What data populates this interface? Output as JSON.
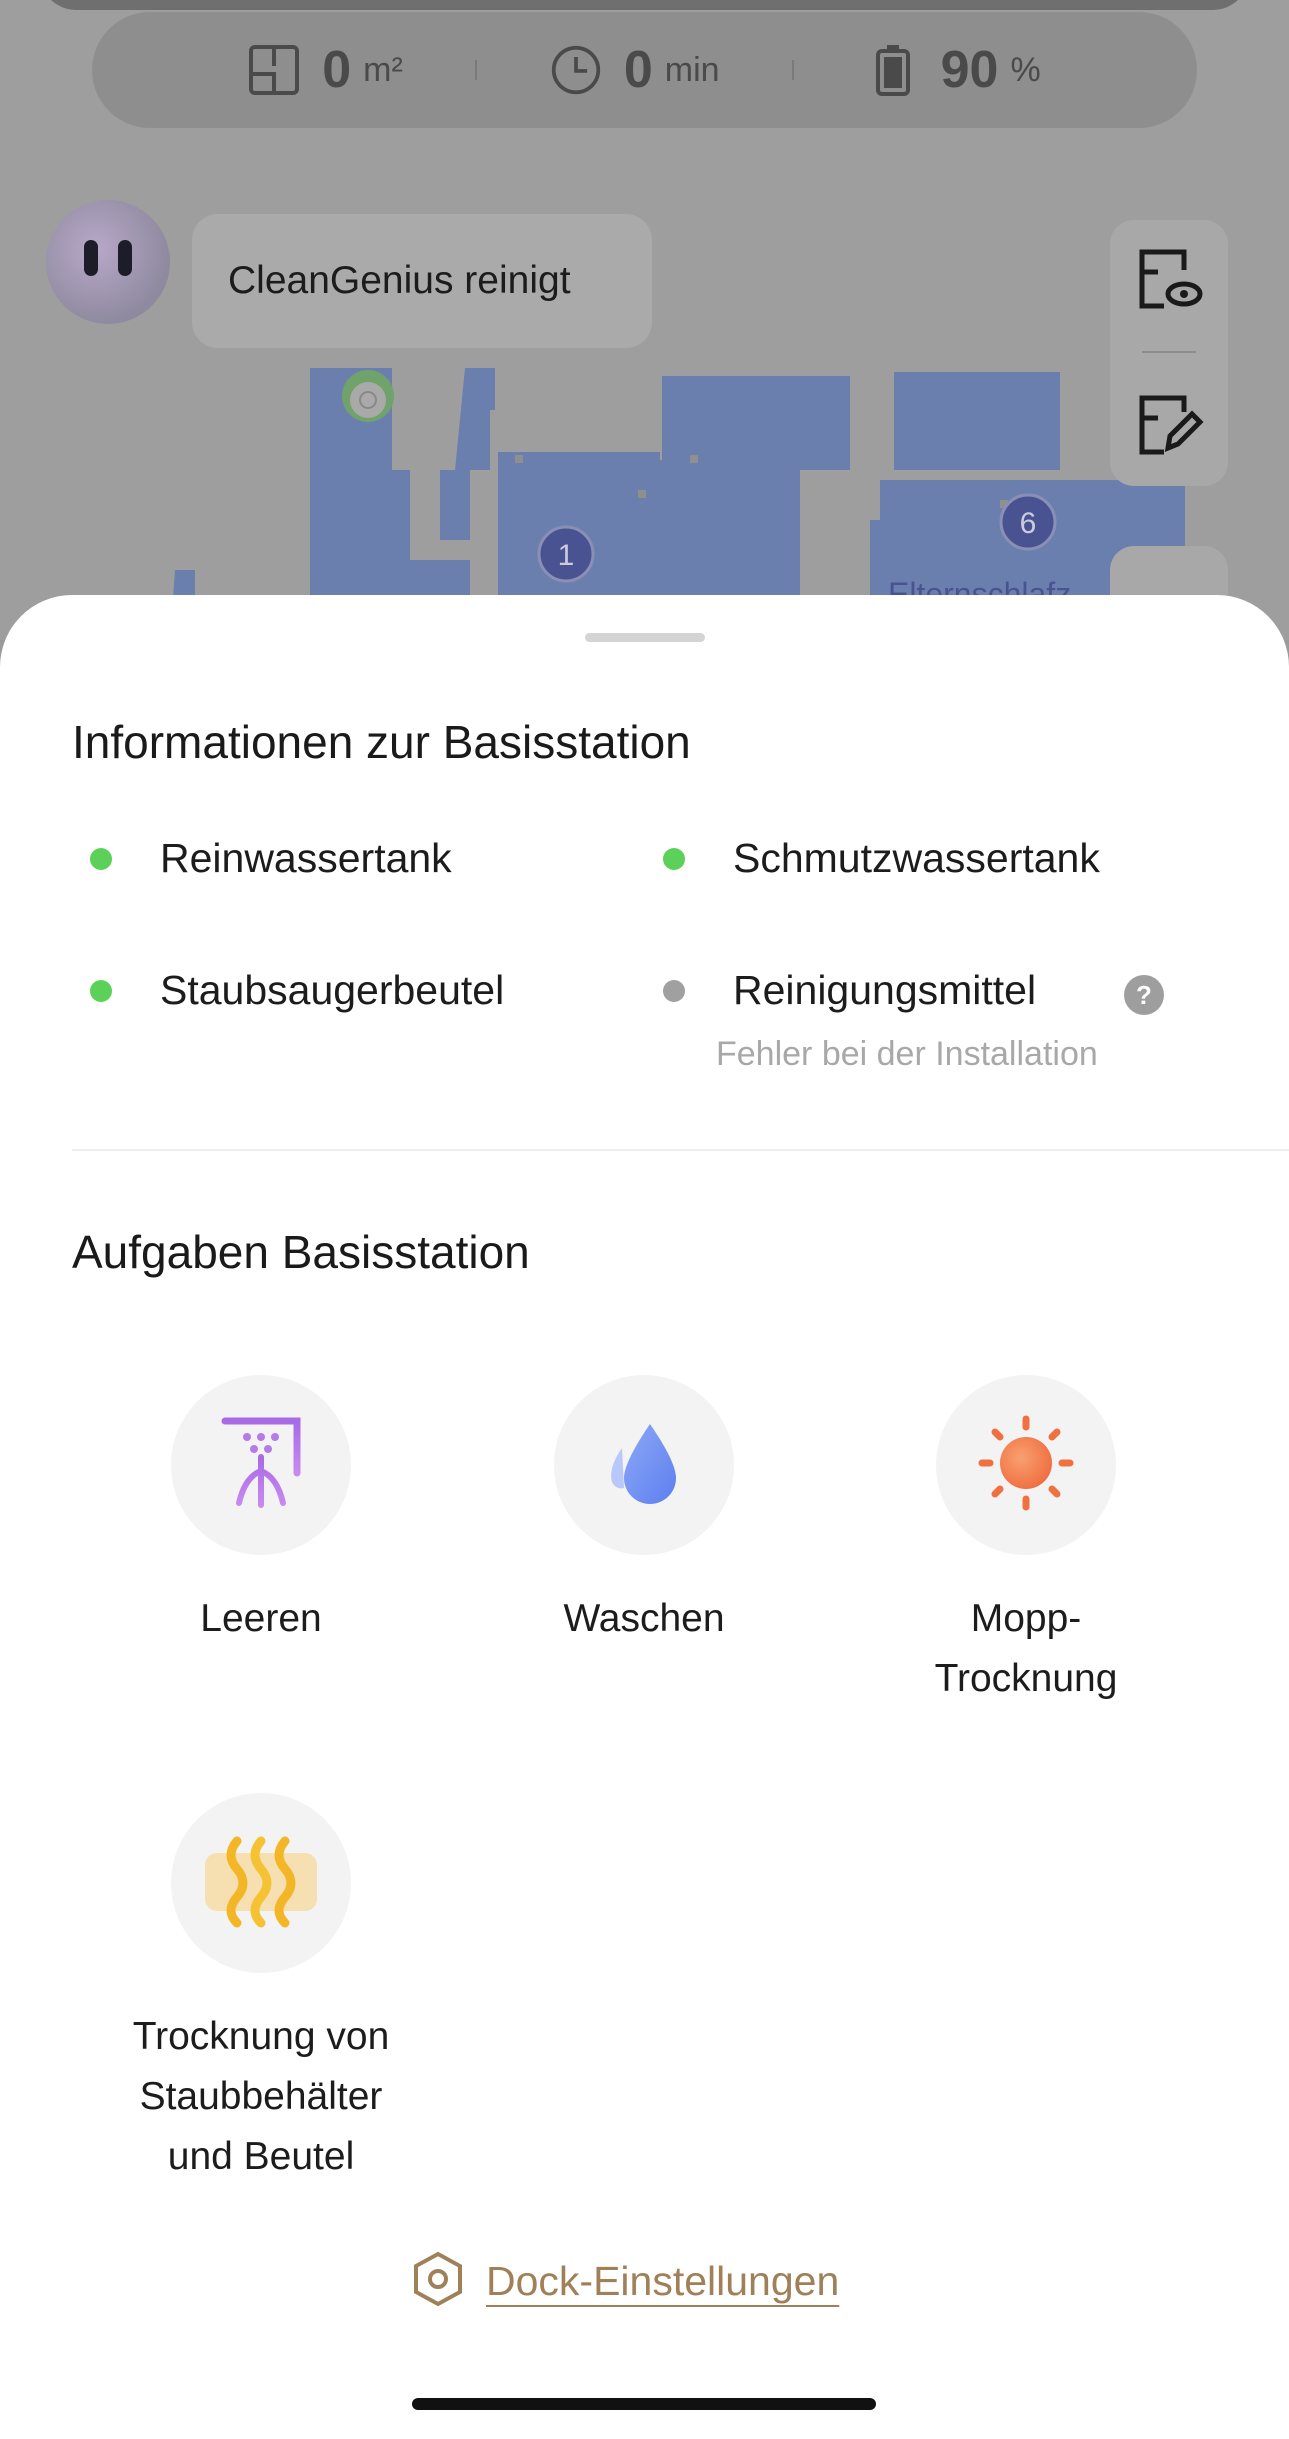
{
  "stats": {
    "area_value": "0",
    "area_unit": "m²",
    "time_value": "0",
    "time_unit": "min",
    "battery_value": "90",
    "battery_unit": "%"
  },
  "genius": {
    "message": "CleanGenius reinigt"
  },
  "map": {
    "room_badges": [
      "1",
      "6"
    ],
    "room_label": "Elternschlafz"
  },
  "station_info": {
    "title": "Informationen zur Basisstation",
    "items": [
      {
        "label": "Reinwassertank",
        "status_color": "#5bd15a"
      },
      {
        "label": "Schmutzwassertank",
        "status_color": "#5bd15a"
      },
      {
        "label": "Staubsaugerbeutel",
        "status_color": "#5bd15a"
      },
      {
        "label": "Reinigungsmittel",
        "status_color": "#a0a0a0",
        "error": "Fehler bei der Installation",
        "help": "?"
      }
    ]
  },
  "tasks": {
    "title": "Aufgaben Basisstation",
    "items": [
      {
        "label": "Leeren",
        "icon": "empty-bin-icon"
      },
      {
        "label": "Waschen",
        "icon": "water-drop-icon"
      },
      {
        "label": "Mopp-\nTrocknung",
        "icon": "sun-icon"
      },
      {
        "label": "Trocknung von\nStaubbehälter\nund Beutel",
        "icon": "heat-waves-icon"
      }
    ]
  },
  "dock_settings": {
    "label": "Dock-Einstellungen"
  },
  "colors": {
    "accent": "#a08058",
    "status_ok": "#5bd15a",
    "status_off": "#a0a0a0",
    "map_room": "#6b7fae"
  }
}
